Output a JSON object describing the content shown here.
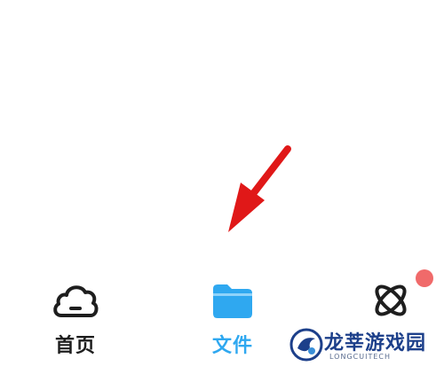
{
  "tabbar": {
    "active_color": "#2fa8f0",
    "items": [
      {
        "label": "首页",
        "icon": "cloud-icon",
        "active": false
      },
      {
        "label": "文件",
        "icon": "folder-icon",
        "active": true
      },
      {
        "label": "",
        "icon": "atom-icon",
        "active": false,
        "badge": true
      }
    ]
  },
  "annotation": {
    "arrow_color": "#e01818"
  },
  "watermark": {
    "title": "龙莘游戏园",
    "subtitle": "LONGCUITECH"
  }
}
